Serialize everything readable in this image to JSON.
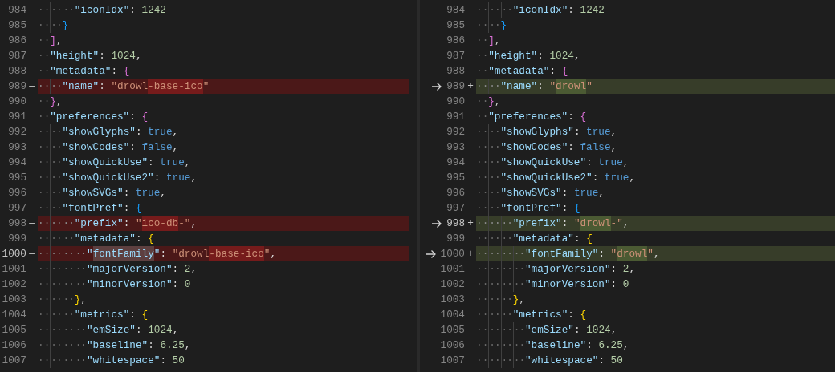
{
  "panes": [
    {
      "kind": "original",
      "lines": [
        {
          "number": "984",
          "removed": false,
          "active": false,
          "indent": "······",
          "tokens": [
            {
              "kind": "key",
              "text": "\"iconIdx\""
            },
            {
              "kind": "punct",
              "text": ": "
            },
            {
              "kind": "number",
              "text": "1242"
            }
          ]
        },
        {
          "number": "985",
          "removed": false,
          "active": false,
          "indent": "····",
          "tokens": [
            {
              "kind": "bracket",
              "text": "}",
              "color": "#179fff"
            }
          ]
        },
        {
          "number": "986",
          "removed": false,
          "active": false,
          "indent": "··",
          "tokens": [
            {
              "kind": "bracket",
              "text": "]",
              "color": "#da70d6"
            },
            {
              "kind": "punct",
              "text": ","
            }
          ]
        },
        {
          "number": "987",
          "removed": false,
          "active": false,
          "indent": "··",
          "tokens": [
            {
              "kind": "key",
              "text": "\"height\""
            },
            {
              "kind": "punct",
              "text": ": "
            },
            {
              "kind": "number",
              "text": "1024"
            },
            {
              "kind": "punct",
              "text": ","
            }
          ]
        },
        {
          "number": "988",
          "removed": false,
          "active": false,
          "indent": "··",
          "tokens": [
            {
              "kind": "key",
              "text": "\"metadata\""
            },
            {
              "kind": "punct",
              "text": ": "
            },
            {
              "kind": "bracket",
              "text": "{",
              "color": "#da70d6"
            }
          ]
        },
        {
          "number": "989",
          "removed": true,
          "active": false,
          "marker": "—",
          "indent": "····",
          "tokens": [
            {
              "kind": "key",
              "text": "\"name\""
            },
            {
              "kind": "punct",
              "text": ": "
            },
            {
              "kind": "string",
              "text": "\"drowl"
            },
            {
              "kind": "string",
              "text": "-base-ico",
              "changed": true
            },
            {
              "kind": "string",
              "text": "\""
            }
          ]
        },
        {
          "number": "990",
          "removed": false,
          "active": false,
          "indent": "··",
          "tokens": [
            {
              "kind": "bracket",
              "text": "}",
              "color": "#da70d6"
            },
            {
              "kind": "punct",
              "text": ","
            }
          ]
        },
        {
          "number": "991",
          "removed": false,
          "active": false,
          "indent": "··",
          "tokens": [
            {
              "kind": "key",
              "text": "\"preferences\""
            },
            {
              "kind": "punct",
              "text": ": "
            },
            {
              "kind": "bracket",
              "text": "{",
              "color": "#da70d6"
            }
          ]
        },
        {
          "number": "992",
          "removed": false,
          "active": false,
          "indent": "····",
          "tokens": [
            {
              "kind": "key",
              "text": "\"showGlyphs\""
            },
            {
              "kind": "punct",
              "text": ": "
            },
            {
              "kind": "bool",
              "text": "true"
            },
            {
              "kind": "punct",
              "text": ","
            }
          ]
        },
        {
          "number": "993",
          "removed": false,
          "active": false,
          "indent": "····",
          "tokens": [
            {
              "kind": "key",
              "text": "\"showCodes\""
            },
            {
              "kind": "punct",
              "text": ": "
            },
            {
              "kind": "bool",
              "text": "false"
            },
            {
              "kind": "punct",
              "text": ","
            }
          ]
        },
        {
          "number": "994",
          "removed": false,
          "active": false,
          "indent": "····",
          "tokens": [
            {
              "kind": "key",
              "text": "\"showQuickUse\""
            },
            {
              "kind": "punct",
              "text": ": "
            },
            {
              "kind": "bool",
              "text": "true"
            },
            {
              "kind": "punct",
              "text": ","
            }
          ]
        },
        {
          "number": "995",
          "removed": false,
          "active": false,
          "indent": "····",
          "tokens": [
            {
              "kind": "key",
              "text": "\"showQuickUse2\""
            },
            {
              "kind": "punct",
              "text": ": "
            },
            {
              "kind": "bool",
              "text": "true"
            },
            {
              "kind": "punct",
              "text": ","
            }
          ]
        },
        {
          "number": "996",
          "removed": false,
          "active": false,
          "indent": "····",
          "tokens": [
            {
              "kind": "key",
              "text": "\"showSVGs\""
            },
            {
              "kind": "punct",
              "text": ": "
            },
            {
              "kind": "bool",
              "text": "true"
            },
            {
              "kind": "punct",
              "text": ","
            }
          ]
        },
        {
          "number": "997",
          "removed": false,
          "active": false,
          "indent": "····",
          "tokens": [
            {
              "kind": "key",
              "text": "\"fontPref\""
            },
            {
              "kind": "punct",
              "text": ": "
            },
            {
              "kind": "bracket",
              "text": "{",
              "color": "#179fff"
            }
          ]
        },
        {
          "number": "998",
          "removed": true,
          "active": false,
          "marker": "—",
          "indent": "······",
          "tokens": [
            {
              "kind": "key",
              "text": "\"prefix\""
            },
            {
              "kind": "punct",
              "text": ": "
            },
            {
              "kind": "string",
              "text": "\""
            },
            {
              "kind": "string",
              "text": "ico-db",
              "changed": true
            },
            {
              "kind": "string",
              "text": "-\""
            },
            {
              "kind": "punct",
              "text": ","
            }
          ]
        },
        {
          "number": "999",
          "removed": false,
          "active": false,
          "indent": "······",
          "tokens": [
            {
              "kind": "key",
              "text": "\"metadata\""
            },
            {
              "kind": "punct",
              "text": ": "
            },
            {
              "kind": "bracket",
              "text": "{",
              "color": "#ffd700"
            }
          ]
        },
        {
          "number": "1000",
          "removed": true,
          "active": true,
          "marker": "—",
          "indent": "········",
          "tokens": [
            {
              "kind": "key",
              "text": "\""
            },
            {
              "kind": "key",
              "text": "fontFamily",
              "highlighted": true
            },
            {
              "kind": "key",
              "text": "\""
            },
            {
              "kind": "punct",
              "text": ": "
            },
            {
              "kind": "string",
              "text": "\"drowl"
            },
            {
              "kind": "string",
              "text": "-base-ico",
              "changed": true
            },
            {
              "kind": "string",
              "text": "\""
            },
            {
              "kind": "punct",
              "text": ","
            }
          ]
        },
        {
          "number": "1001",
          "removed": false,
          "active": false,
          "indent": "········",
          "tokens": [
            {
              "kind": "key",
              "text": "\"majorVersion\""
            },
            {
              "kind": "punct",
              "text": ": "
            },
            {
              "kind": "number",
              "text": "2"
            },
            {
              "kind": "punct",
              "text": ","
            }
          ]
        },
        {
          "number": "1002",
          "removed": false,
          "active": false,
          "indent": "········",
          "tokens": [
            {
              "kind": "key",
              "text": "\"minorVersion\""
            },
            {
              "kind": "punct",
              "text": ": "
            },
            {
              "kind": "number",
              "text": "0"
            }
          ]
        },
        {
          "number": "1003",
          "removed": false,
          "active": false,
          "indent": "······",
          "tokens": [
            {
              "kind": "bracket",
              "text": "}",
              "color": "#ffd700"
            },
            {
              "kind": "punct",
              "text": ","
            }
          ]
        },
        {
          "number": "1004",
          "removed": false,
          "active": false,
          "indent": "······",
          "tokens": [
            {
              "kind": "key",
              "text": "\"metrics\""
            },
            {
              "kind": "punct",
              "text": ": "
            },
            {
              "kind": "bracket",
              "text": "{",
              "color": "#ffd700"
            }
          ]
        },
        {
          "number": "1005",
          "removed": false,
          "active": false,
          "indent": "········",
          "tokens": [
            {
              "kind": "key",
              "text": "\"emSize\""
            },
            {
              "kind": "punct",
              "text": ": "
            },
            {
              "kind": "number",
              "text": "1024"
            },
            {
              "kind": "punct",
              "text": ","
            }
          ]
        },
        {
          "number": "1006",
          "removed": false,
          "active": false,
          "indent": "········",
          "tokens": [
            {
              "kind": "key",
              "text": "\"baseline\""
            },
            {
              "kind": "punct",
              "text": ": "
            },
            {
              "kind": "number",
              "text": "6.25"
            },
            {
              "kind": "punct",
              "text": ","
            }
          ]
        },
        {
          "number": "1007",
          "removed": false,
          "active": false,
          "indent": "········",
          "tokens": [
            {
              "kind": "key",
              "text": "\"whitespace\""
            },
            {
              "kind": "punct",
              "text": ": "
            },
            {
              "kind": "number",
              "text": "50"
            }
          ]
        }
      ]
    },
    {
      "kind": "modified",
      "lines": [
        {
          "number": "984",
          "added": false,
          "active": false,
          "indent": "······",
          "tokens": [
            {
              "kind": "key",
              "text": "\"iconIdx\""
            },
            {
              "kind": "punct",
              "text": ": "
            },
            {
              "kind": "number",
              "text": "1242"
            }
          ]
        },
        {
          "number": "985",
          "added": false,
          "active": false,
          "indent": "····",
          "tokens": [
            {
              "kind": "bracket",
              "text": "}",
              "color": "#179fff"
            }
          ]
        },
        {
          "number": "986",
          "added": false,
          "active": false,
          "indent": "··",
          "tokens": [
            {
              "kind": "bracket",
              "text": "]",
              "color": "#da70d6"
            },
            {
              "kind": "punct",
              "text": ","
            }
          ]
        },
        {
          "number": "987",
          "added": false,
          "active": false,
          "indent": "··",
          "tokens": [
            {
              "kind": "key",
              "text": "\"height\""
            },
            {
              "kind": "punct",
              "text": ": "
            },
            {
              "kind": "number",
              "text": "1024"
            },
            {
              "kind": "punct",
              "text": ","
            }
          ]
        },
        {
          "number": "988",
          "added": false,
          "active": false,
          "indent": "··",
          "tokens": [
            {
              "kind": "key",
              "text": "\"metadata\""
            },
            {
              "kind": "punct",
              "text": ": "
            },
            {
              "kind": "bracket",
              "text": "{",
              "color": "#da70d6"
            }
          ]
        },
        {
          "number": "989",
          "added": true,
          "active": false,
          "marker": "+",
          "indent": "····",
          "tokens": [
            {
              "kind": "key",
              "text": "\"name\""
            },
            {
              "kind": "punct",
              "text": ": "
            },
            {
              "kind": "string",
              "text": "\""
            },
            {
              "kind": "string",
              "text": "drowl",
              "changed": true
            },
            {
              "kind": "string",
              "text": "\""
            }
          ]
        },
        {
          "number": "990",
          "added": false,
          "active": false,
          "indent": "··",
          "tokens": [
            {
              "kind": "bracket",
              "text": "}",
              "color": "#da70d6"
            },
            {
              "kind": "punct",
              "text": ","
            }
          ]
        },
        {
          "number": "991",
          "added": false,
          "active": false,
          "indent": "··",
          "tokens": [
            {
              "kind": "key",
              "text": "\"preferences\""
            },
            {
              "kind": "punct",
              "text": ": "
            },
            {
              "kind": "bracket",
              "text": "{",
              "color": "#da70d6"
            }
          ]
        },
        {
          "number": "992",
          "added": false,
          "active": false,
          "indent": "····",
          "tokens": [
            {
              "kind": "key",
              "text": "\"showGlyphs\""
            },
            {
              "kind": "punct",
              "text": ": "
            },
            {
              "kind": "bool",
              "text": "true"
            },
            {
              "kind": "punct",
              "text": ","
            }
          ]
        },
        {
          "number": "993",
          "added": false,
          "active": false,
          "indent": "····",
          "tokens": [
            {
              "kind": "key",
              "text": "\"showCodes\""
            },
            {
              "kind": "punct",
              "text": ": "
            },
            {
              "kind": "bool",
              "text": "false"
            },
            {
              "kind": "punct",
              "text": ","
            }
          ]
        },
        {
          "number": "994",
          "added": false,
          "active": false,
          "indent": "····",
          "tokens": [
            {
              "kind": "key",
              "text": "\"showQuickUse\""
            },
            {
              "kind": "punct",
              "text": ": "
            },
            {
              "kind": "bool",
              "text": "true"
            },
            {
              "kind": "punct",
              "text": ","
            }
          ]
        },
        {
          "number": "995",
          "added": false,
          "active": false,
          "indent": "····",
          "tokens": [
            {
              "kind": "key",
              "text": "\"showQuickUse2\""
            },
            {
              "kind": "punct",
              "text": ": "
            },
            {
              "kind": "bool",
              "text": "true"
            },
            {
              "kind": "punct",
              "text": ","
            }
          ]
        },
        {
          "number": "996",
          "added": false,
          "active": false,
          "indent": "····",
          "tokens": [
            {
              "kind": "key",
              "text": "\"showSVGs\""
            },
            {
              "kind": "punct",
              "text": ": "
            },
            {
              "kind": "bool",
              "text": "true"
            },
            {
              "kind": "punct",
              "text": ","
            }
          ]
        },
        {
          "number": "997",
          "added": false,
          "active": false,
          "indent": "····",
          "tokens": [
            {
              "kind": "key",
              "text": "\"fontPref\""
            },
            {
              "kind": "punct",
              "text": ": "
            },
            {
              "kind": "bracket",
              "text": "{",
              "color": "#179fff"
            }
          ]
        },
        {
          "number": "998",
          "added": true,
          "active": true,
          "marker": "+",
          "indent": "······",
          "tokens": [
            {
              "kind": "key",
              "text": "\"prefix\""
            },
            {
              "kind": "punct",
              "text": ": "
            },
            {
              "kind": "string",
              "text": "\""
            },
            {
              "kind": "string",
              "text": "drowl",
              "changed": true
            },
            {
              "kind": "string",
              "text": "-\""
            },
            {
              "kind": "punct",
              "text": ","
            }
          ]
        },
        {
          "number": "999",
          "added": false,
          "active": false,
          "indent": "······",
          "tokens": [
            {
              "kind": "key",
              "text": "\"metadata\""
            },
            {
              "kind": "punct",
              "text": ": "
            },
            {
              "kind": "bracket",
              "text": "{",
              "color": "#ffd700"
            }
          ]
        },
        {
          "number": "1000",
          "added": true,
          "active": false,
          "marker": "+",
          "indent": "········",
          "tokens": [
            {
              "kind": "key",
              "text": "\"fontFamily\""
            },
            {
              "kind": "punct",
              "text": ": "
            },
            {
              "kind": "string",
              "text": "\""
            },
            {
              "kind": "string",
              "text": "drowl",
              "changed": true
            },
            {
              "kind": "string",
              "text": "\""
            },
            {
              "kind": "punct",
              "text": ","
            }
          ]
        },
        {
          "number": "1001",
          "added": false,
          "active": false,
          "indent": "········",
          "tokens": [
            {
              "kind": "key",
              "text": "\"majorVersion\""
            },
            {
              "kind": "punct",
              "text": ": "
            },
            {
              "kind": "number",
              "text": "2"
            },
            {
              "kind": "punct",
              "text": ","
            }
          ]
        },
        {
          "number": "1002",
          "added": false,
          "active": false,
          "indent": "········",
          "tokens": [
            {
              "kind": "key",
              "text": "\"minorVersion\""
            },
            {
              "kind": "punct",
              "text": ": "
            },
            {
              "kind": "number",
              "text": "0"
            }
          ]
        },
        {
          "number": "1003",
          "added": false,
          "active": false,
          "indent": "······",
          "tokens": [
            {
              "kind": "bracket",
              "text": "}",
              "color": "#ffd700"
            },
            {
              "kind": "punct",
              "text": ","
            }
          ]
        },
        {
          "number": "1004",
          "added": false,
          "active": false,
          "indent": "······",
          "tokens": [
            {
              "kind": "key",
              "text": "\"metrics\""
            },
            {
              "kind": "punct",
              "text": ": "
            },
            {
              "kind": "bracket",
              "text": "{",
              "color": "#ffd700"
            }
          ]
        },
        {
          "number": "1005",
          "added": false,
          "active": false,
          "indent": "········",
          "tokens": [
            {
              "kind": "key",
              "text": "\"emSize\""
            },
            {
              "kind": "punct",
              "text": ": "
            },
            {
              "kind": "number",
              "text": "1024"
            },
            {
              "kind": "punct",
              "text": ","
            }
          ]
        },
        {
          "number": "1006",
          "added": false,
          "active": false,
          "indent": "········",
          "tokens": [
            {
              "kind": "key",
              "text": "\"baseline\""
            },
            {
              "kind": "punct",
              "text": ": "
            },
            {
              "kind": "number",
              "text": "6.25"
            },
            {
              "kind": "punct",
              "text": ","
            }
          ]
        },
        {
          "number": "1007",
          "added": false,
          "active": false,
          "indent": "········",
          "tokens": [
            {
              "kind": "key",
              "text": "\"whitespace\""
            },
            {
              "kind": "punct",
              "text": ": "
            },
            {
              "kind": "number",
              "text": "50"
            }
          ]
        }
      ]
    }
  ]
}
